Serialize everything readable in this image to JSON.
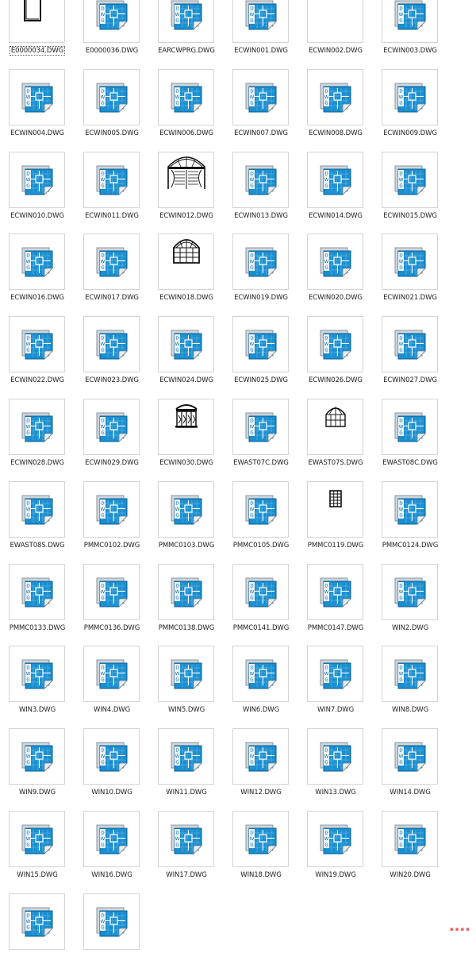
{
  "files": [
    {
      "name": "E0000034.DWG",
      "thumb": "door",
      "selected": true
    },
    {
      "name": "E0000036.DWG",
      "thumb": "dwg"
    },
    {
      "name": "EARCWPRG.DWG",
      "thumb": "dwg"
    },
    {
      "name": "ECWIN001.DWG",
      "thumb": "dwg"
    },
    {
      "name": "ECWIN002.DWG",
      "thumb": "small-window"
    },
    {
      "name": "ECWIN003.DWG",
      "thumb": "dwg"
    },
    {
      "name": "ECWIN004.DWG",
      "thumb": "dwg"
    },
    {
      "name": "ECWIN005.DWG",
      "thumb": "dwg"
    },
    {
      "name": "ECWIN006.DWG",
      "thumb": "dwg"
    },
    {
      "name": "ECWIN007.DWG",
      "thumb": "dwg"
    },
    {
      "name": "ECWIN008.DWG",
      "thumb": "dwg"
    },
    {
      "name": "ECWIN009.DWG",
      "thumb": "dwg"
    },
    {
      "name": "ECWIN010.DWG",
      "thumb": "dwg"
    },
    {
      "name": "ECWIN011.DWG",
      "thumb": "dwg"
    },
    {
      "name": "ECWIN012.DWG",
      "thumb": "arch-window-shutter"
    },
    {
      "name": "ECWIN013.DWG",
      "thumb": "dwg"
    },
    {
      "name": "ECWIN014.DWG",
      "thumb": "dwg"
    },
    {
      "name": "ECWIN015.DWG",
      "thumb": "dwg"
    },
    {
      "name": "ECWIN016.DWG",
      "thumb": "dwg"
    },
    {
      "name": "ECWIN017.DWG",
      "thumb": "dwg"
    },
    {
      "name": "ECWIN018.DWG",
      "thumb": "arch-window-grid"
    },
    {
      "name": "ECWIN019.DWG",
      "thumb": "dwg"
    },
    {
      "name": "ECWIN020.DWG",
      "thumb": "dwg"
    },
    {
      "name": "ECWIN021.DWG",
      "thumb": "dwg"
    },
    {
      "name": "ECWIN022.DWG",
      "thumb": "dwg"
    },
    {
      "name": "ECWIN023.DWG",
      "thumb": "dwg"
    },
    {
      "name": "ECWIN024.DWG",
      "thumb": "dwg"
    },
    {
      "name": "ECWIN025.DWG",
      "thumb": "dwg"
    },
    {
      "name": "ECWIN026.DWG",
      "thumb": "dwg"
    },
    {
      "name": "ECWIN027.DWG",
      "thumb": "dwg"
    },
    {
      "name": "ECWIN028.DWG",
      "thumb": "dwg"
    },
    {
      "name": "ECWIN029.DWG",
      "thumb": "dwg"
    },
    {
      "name": "ECWIN030.DWG",
      "thumb": "ornate-window"
    },
    {
      "name": "EWAST07C.DWG",
      "thumb": "dwg"
    },
    {
      "name": "EWAST07S.DWG",
      "thumb": "gothic-window"
    },
    {
      "name": "EWAST08C.DWG",
      "thumb": "dwg"
    },
    {
      "name": "EWAST08S.DWG",
      "thumb": "dwg"
    },
    {
      "name": "PMMC0102.DWG",
      "thumb": "dwg"
    },
    {
      "name": "PMMC0103.DWG",
      "thumb": "dwg"
    },
    {
      "name": "PMMC0105.DWG",
      "thumb": "dwg"
    },
    {
      "name": "PMMC0119.DWG",
      "thumb": "tall-grid-window"
    },
    {
      "name": "PMMC0124.DWG",
      "thumb": "dwg"
    },
    {
      "name": "PMMC0133.DWG",
      "thumb": "dwg"
    },
    {
      "name": "PMMC0136.DWG",
      "thumb": "dwg"
    },
    {
      "name": "PMMC0138.DWG",
      "thumb": "dwg"
    },
    {
      "name": "PMMC0141.DWG",
      "thumb": "dwg"
    },
    {
      "name": "PMMC0147.DWG",
      "thumb": "dwg"
    },
    {
      "name": "WIN2.DWG",
      "thumb": "dwg"
    },
    {
      "name": "WIN3.DWG",
      "thumb": "dwg"
    },
    {
      "name": "WIN4.DWG",
      "thumb": "dwg"
    },
    {
      "name": "WIN5.DWG",
      "thumb": "dwg"
    },
    {
      "name": "WIN6.DWG",
      "thumb": "dwg"
    },
    {
      "name": "WIN7.DWG",
      "thumb": "dwg"
    },
    {
      "name": "WIN8.DWG",
      "thumb": "dwg"
    },
    {
      "name": "WIN9.DWG",
      "thumb": "dwg"
    },
    {
      "name": "WIN10.DWG",
      "thumb": "dwg"
    },
    {
      "name": "WIN11.DWG",
      "thumb": "dwg"
    },
    {
      "name": "WIN12.DWG",
      "thumb": "dwg"
    },
    {
      "name": "WIN13.DWG",
      "thumb": "dwg"
    },
    {
      "name": "WIN14.DWG",
      "thumb": "dwg"
    },
    {
      "name": "WIN15.DWG",
      "thumb": "dwg"
    },
    {
      "name": "WIN16.DWG",
      "thumb": "dwg"
    },
    {
      "name": "WIN17.DWG",
      "thumb": "dwg"
    },
    {
      "name": "WIN18.DWG",
      "thumb": "dwg"
    },
    {
      "name": "WIN19.DWG",
      "thumb": "dwg"
    },
    {
      "name": "WIN20.DWG",
      "thumb": "dwg"
    },
    {
      "name": "",
      "thumb": "dwg"
    },
    {
      "name": "",
      "thumb": "dwg"
    }
  ],
  "icon_text": "DWG",
  "colors": {
    "dwg_blue": "#1a8fd0",
    "dwg_dark": "#0b5f96",
    "dwg_paper": "#cfd6dc",
    "line": "#111111"
  }
}
